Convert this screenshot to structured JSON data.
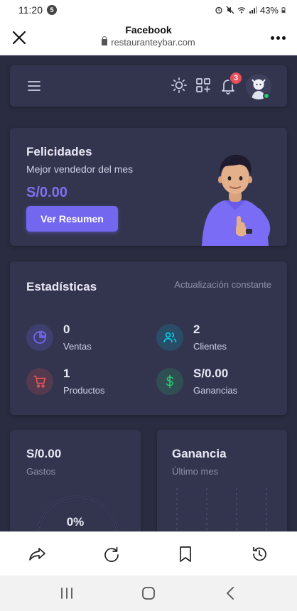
{
  "status_bar": {
    "time": "11:20",
    "notification_count": "5",
    "battery": "43%"
  },
  "browser": {
    "title": "Facebook",
    "url": "restauranteybar.com"
  },
  "topbar": {
    "notification_badge": "3"
  },
  "congrats": {
    "title": "Felicidades",
    "subtitle": "Mejor vendedor del mes",
    "amount": "S/0.00",
    "button": "Ver Resumen"
  },
  "stats": {
    "title": "Estadísticas",
    "update_label": "Actualización constante",
    "items": [
      {
        "value": "0",
        "label": "Ventas",
        "icon": "pie-chart-icon",
        "color": "#7367f0"
      },
      {
        "value": "2",
        "label": "Clientes",
        "icon": "users-icon",
        "color": "#00cfe8"
      },
      {
        "value": "1",
        "label": "Productos",
        "icon": "cart-icon",
        "color": "#ea5455"
      },
      {
        "value": "S/0.00",
        "label": "Ganancias",
        "icon": "dollar-icon",
        "color": "#28c76f"
      }
    ]
  },
  "gastos": {
    "amount": "S/0.00",
    "label": "Gastos",
    "percent": "0%"
  },
  "ganancia": {
    "title": "Ganancia",
    "subtitle": "Último mes"
  },
  "colors": {
    "app_background": "#2a2c41",
    "card_background": "#33354f",
    "primary": "#7367f0",
    "badge_red": "#ea4d5b",
    "online_green": "#28c76f"
  }
}
